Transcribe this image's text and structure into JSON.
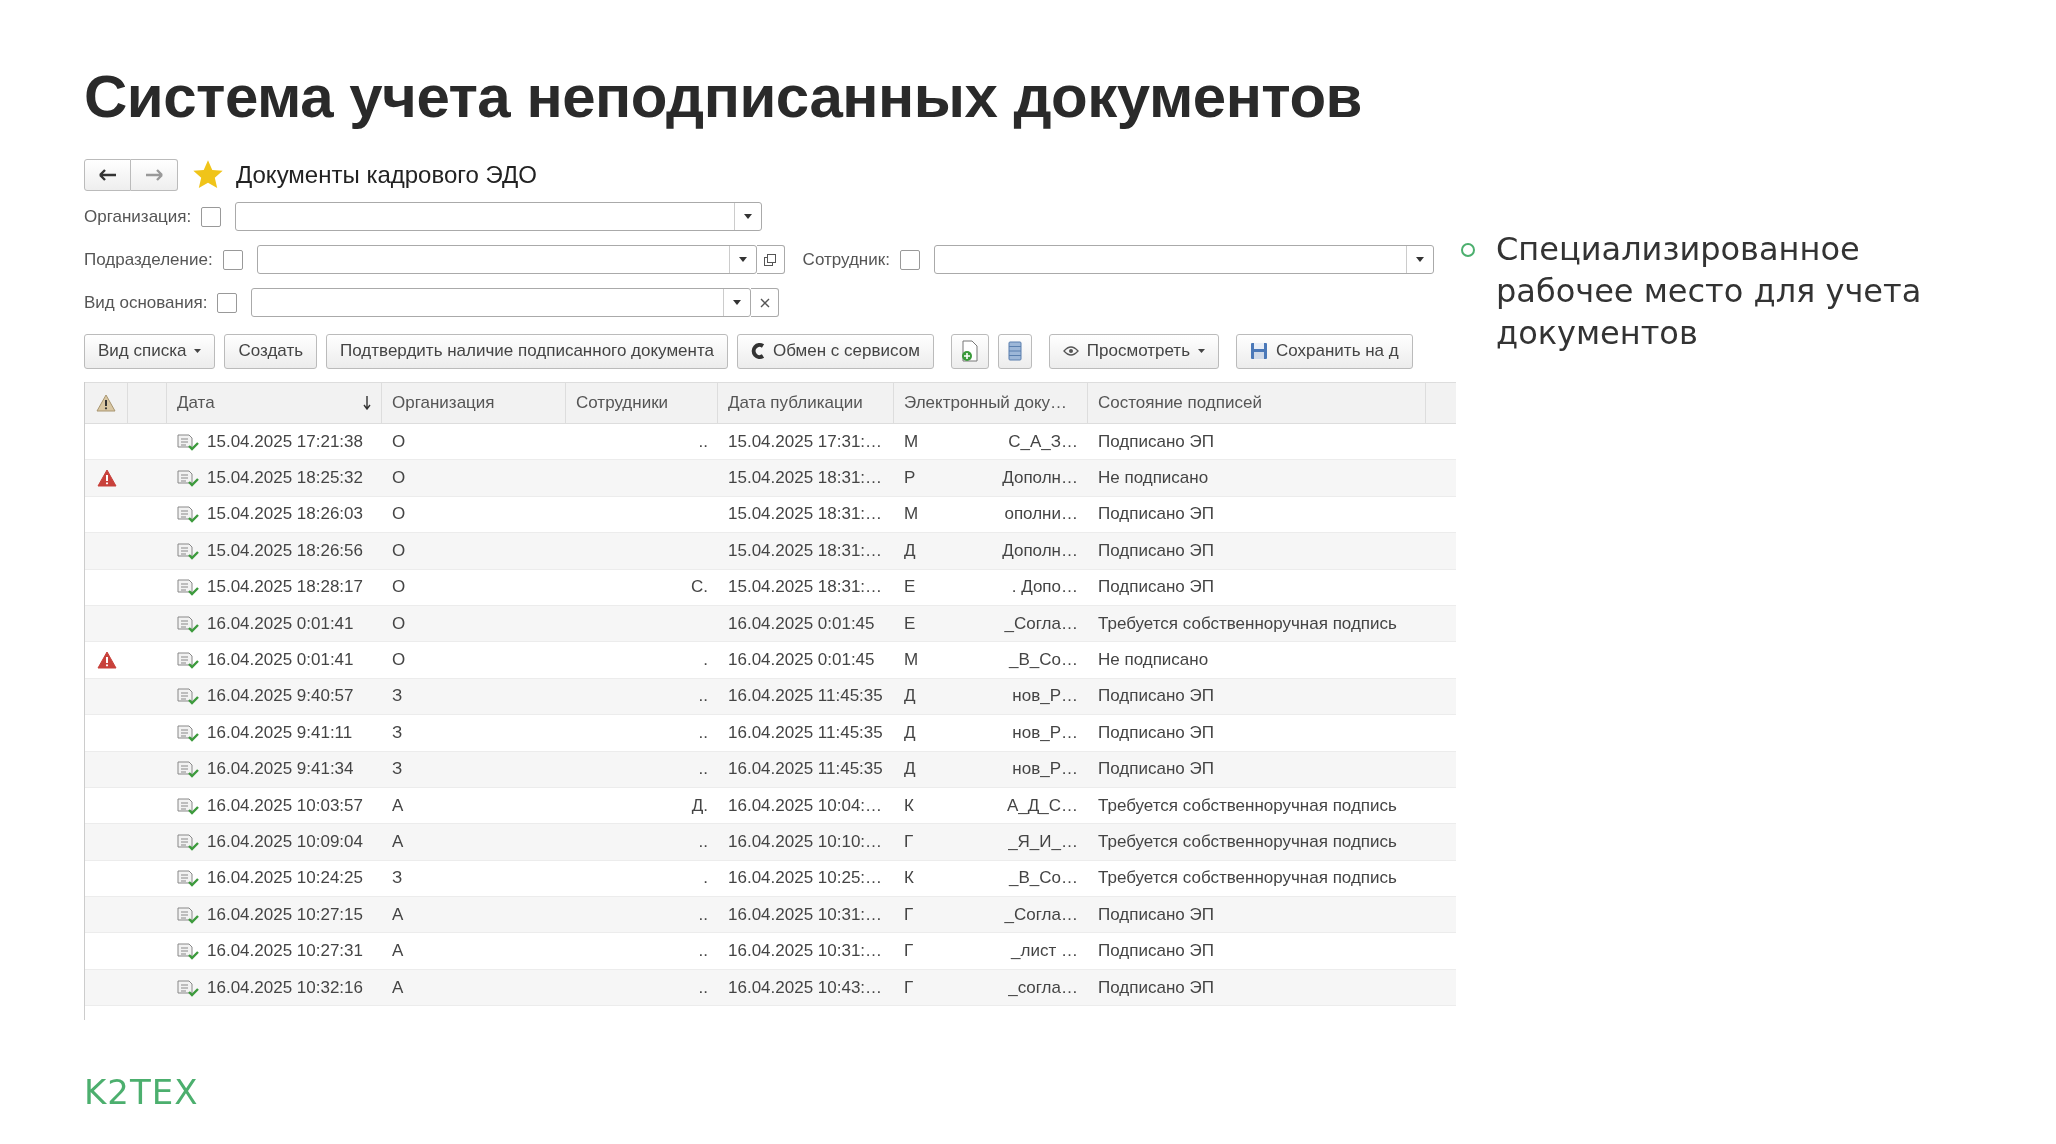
{
  "slide_title": "Система учета неподписанных документов",
  "window": {
    "title": "Документы кадрового ЭДО",
    "favorite": true
  },
  "filter_rows": [
    [
      {
        "label": "Организация:",
        "checked": false
      }
    ],
    [
      {
        "label": "Подразделение:",
        "checked": false
      },
      {
        "label": "Сотрудник:",
        "checked": false
      }
    ],
    [
      {
        "label": "Вид основания:",
        "checked": false
      }
    ]
  ],
  "toolbar": [
    {
      "kind": "dropdown",
      "label": "Вид списка"
    },
    {
      "kind": "button",
      "label": "Создать"
    },
    {
      "kind": "button",
      "label": "Подтвердить наличие подписанного документа"
    },
    {
      "kind": "button",
      "label": "Обмен с сервисом"
    },
    {
      "kind": "icon"
    },
    {
      "kind": "icon"
    },
    {
      "kind": "dropdown",
      "label": "Просмотреть"
    },
    {
      "kind": "button",
      "label": "Сохранить на д"
    }
  ],
  "columns": [
    {
      "kind": "warning",
      "sorted": false
    },
    {
      "kind": "blank",
      "sorted": false
    },
    {
      "kind": "text",
      "label": "Дата",
      "sorted": true
    },
    {
      "kind": "text",
      "label": "Организация",
      "sorted": false
    },
    {
      "kind": "text",
      "label": "Сотрудники",
      "sorted": false
    },
    {
      "kind": "text",
      "label": "Дата публикации",
      "sorted": false
    },
    {
      "kind": "text",
      "label": "Электронный доку…",
      "sorted": false
    },
    {
      "kind": "text",
      "label": "Состояние подписей",
      "sorted": false
    }
  ],
  "rows": [
    {
      "warning": false,
      "date": "15.04.2025 17:21:38",
      "org": "О",
      "employee": "..",
      "published": "15.04.2025 17:31:…",
      "doc_start": "М",
      "doc_end": "С_А_З…",
      "status": "Подписано ЭП"
    },
    {
      "warning": true,
      "date": "15.04.2025 18:25:32",
      "org": "О",
      "published": "15.04.2025 18:31:…",
      "doc_start": "Р",
      "doc_end": "Дополн…",
      "status": "Не подписано"
    },
    {
      "warning": false,
      "date": "15.04.2025 18:26:03",
      "org": "О",
      "published": "15.04.2025 18:31:…",
      "doc_start": "М",
      "doc_end": "ополни…",
      "status": "Подписано ЭП"
    },
    {
      "warning": false,
      "date": "15.04.2025 18:26:56",
      "org": "О",
      "published": "15.04.2025 18:31:…",
      "doc_start": "Д",
      "doc_end": "Дополн…",
      "status": "Подписано ЭП"
    },
    {
      "warning": false,
      "date": "15.04.2025 18:28:17",
      "org": "О",
      "employee": "С.",
      "published": "15.04.2025 18:31:…",
      "doc_start": "Е",
      "doc_end": ". Допо…",
      "status": "Подписано ЭП"
    },
    {
      "warning": false,
      "date": "16.04.2025 0:01:41",
      "org": "О",
      "published": "16.04.2025 0:01:45",
      "doc_start": "Е",
      "doc_end": "_Согла…",
      "status": "Требуется собственноручная подпись"
    },
    {
      "warning": true,
      "date": "16.04.2025 0:01:41",
      "org": "О",
      "employee": ".",
      "published": "16.04.2025 0:01:45",
      "doc_start": "М",
      "doc_end": "_В_Со…",
      "status": "Не подписано"
    },
    {
      "warning": false,
      "date": "16.04.2025 9:40:57",
      "org": "З",
      "employee": "..",
      "published": "16.04.2025 11:45:35",
      "doc_start": "Д",
      "doc_end": "нов_Р…",
      "status": "Подписано ЭП"
    },
    {
      "warning": false,
      "date": "16.04.2025 9:41:11",
      "org": "З",
      "employee": "..",
      "published": "16.04.2025 11:45:35",
      "doc_start": "Д",
      "doc_end": "нов_Р…",
      "status": "Подписано ЭП"
    },
    {
      "warning": false,
      "date": "16.04.2025 9:41:34",
      "org": "З",
      "employee": "..",
      "published": "16.04.2025 11:45:35",
      "doc_start": "Д",
      "doc_end": "нов_Р…",
      "status": "Подписано ЭП"
    },
    {
      "warning": false,
      "date": "16.04.2025 10:03:57",
      "org": "А",
      "employee": "Д.",
      "published": "16.04.2025 10:04:…",
      "doc_start": "К",
      "doc_end": "А_Д_С…",
      "status": "Требуется собственноручная подпись"
    },
    {
      "warning": false,
      "date": "16.04.2025 10:09:04",
      "org": "А",
      "employee": "..",
      "published": "16.04.2025 10:10:…",
      "doc_start": "Г",
      "doc_end": "_Я_И_…",
      "status": "Требуется собственноручная подпись"
    },
    {
      "warning": false,
      "date": "16.04.2025 10:24:25",
      "org": "З",
      "employee": ".",
      "published": "16.04.2025 10:25:…",
      "doc_start": "К",
      "doc_end": "_В_Со…",
      "status": "Требуется собственноручная подпись"
    },
    {
      "warning": false,
      "date": "16.04.2025 10:27:15",
      "org": "А",
      "employee": "..",
      "published": "16.04.2025 10:31:…",
      "doc_start": "Г",
      "doc_end": "_Согла…",
      "status": "Подписано ЭП"
    },
    {
      "warning": false,
      "date": "16.04.2025 10:27:31",
      "org": "А",
      "employee": "..",
      "published": "16.04.2025 10:31:…",
      "doc_start": "Г",
      "doc_end": "_лист …",
      "status": "Подписано ЭП"
    },
    {
      "warning": false,
      "date": "16.04.2025 10:32:16",
      "org": "А",
      "employee": "..",
      "published": "16.04.2025 10:43:…",
      "doc_start": "Г",
      "doc_end": "_согла…",
      "status": "Подписано ЭП"
    }
  ],
  "bullets": [
    "Специализированное рабочее место для учета документов"
  ],
  "logo": "K2TEX"
}
